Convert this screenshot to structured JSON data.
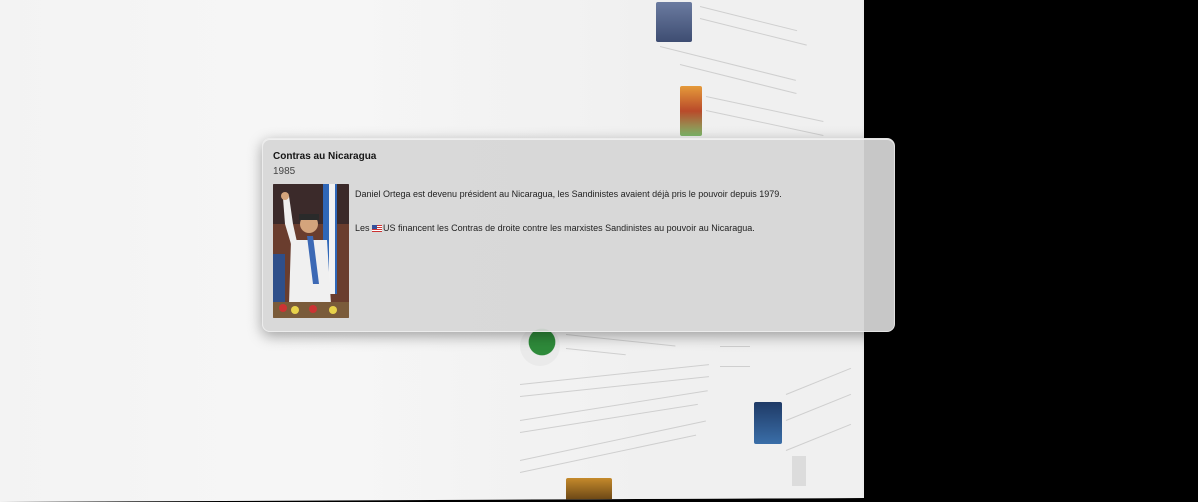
{
  "popover": {
    "title": "Contras au Nicaragua",
    "year": "1985",
    "paragraph1": "Daniel Ortega est devenu président au Nicaragua, les Sandinistes avaient déjà pris le pouvoir depuis 1979.",
    "paragraph2_prefix": "Les ",
    "flag_icon": "us-flag-icon",
    "paragraph2_country": "US",
    "paragraph2_suffix": " financent les Contras de droite contre les marxistes Sandinistes au pouvoir au Nicaragua."
  },
  "colors": {
    "background": "#000000",
    "plane": "#f3f3f3",
    "card": "#d6d6d6",
    "text": "#222222"
  }
}
